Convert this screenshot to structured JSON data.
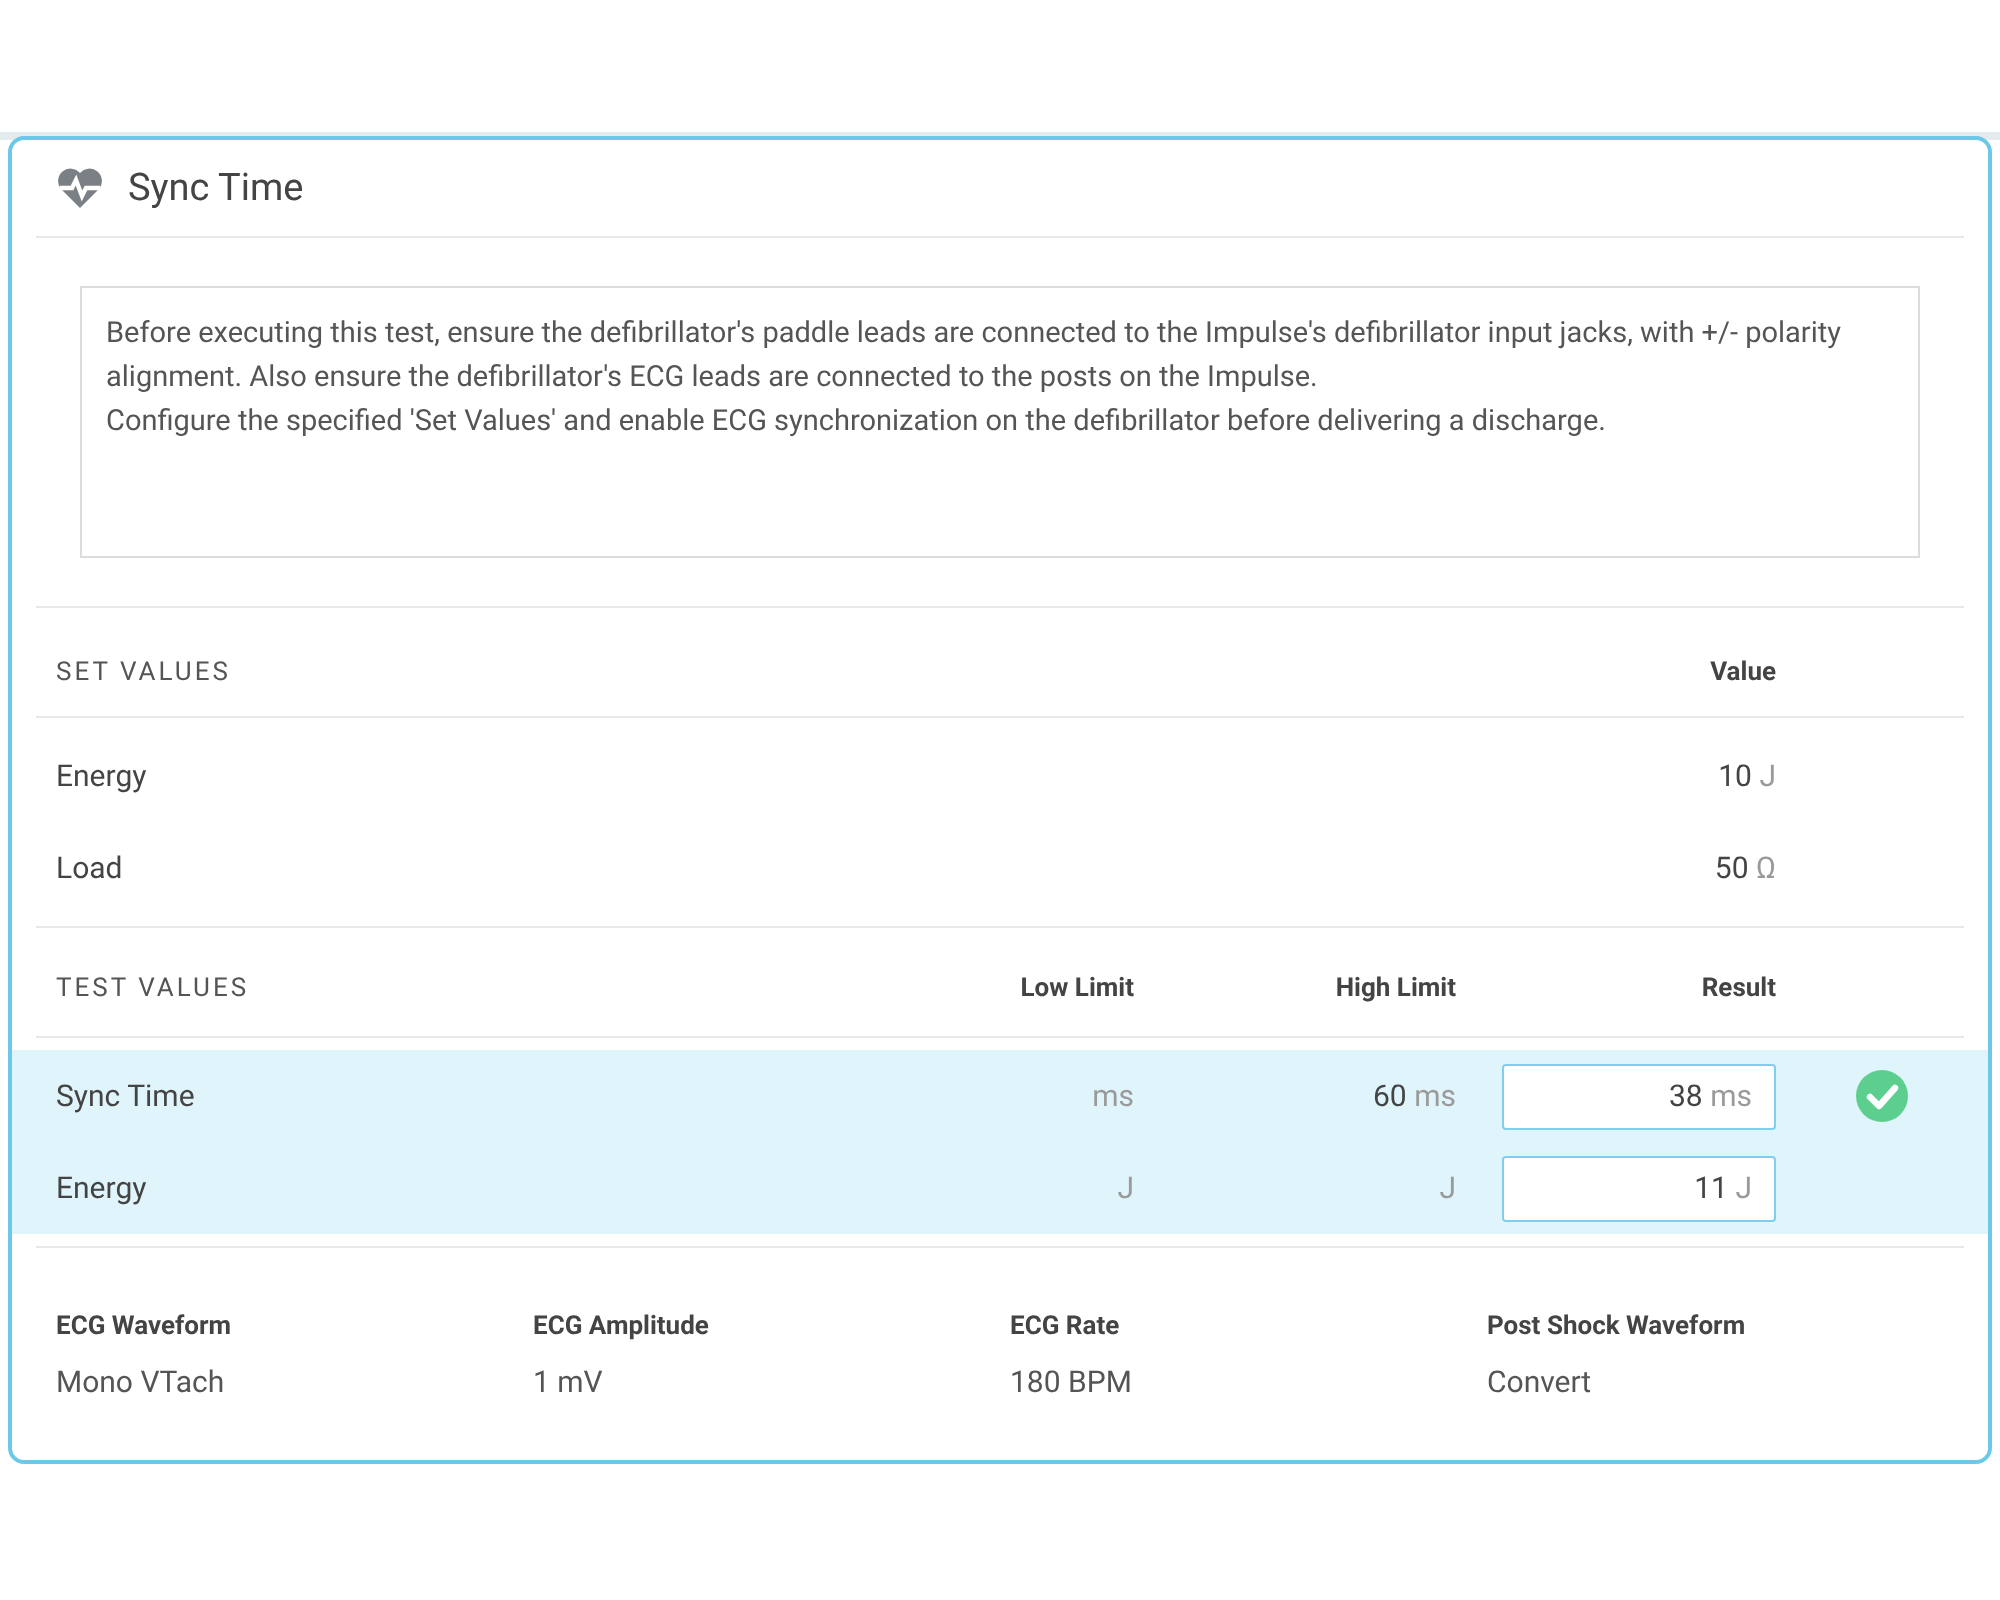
{
  "panel": {
    "title": "Sync Time"
  },
  "instructions": [
    "Before executing this test, ensure the defibrillator's paddle leads are connected to the Impulse's defibrillator input jacks, with +/- polarity alignment. Also ensure the defibrillator's ECG leads are connected to the posts on the Impulse.",
    "Configure the specified 'Set Values' and enable ECG synchronization on the defibrillator before delivering a discharge."
  ],
  "set_values": {
    "heading": "SET VALUES",
    "value_column": "Value",
    "rows": [
      {
        "label": "Energy",
        "value": "10",
        "unit": "J"
      },
      {
        "label": "Load",
        "value": "50",
        "unit": "Ω"
      }
    ]
  },
  "test_values": {
    "heading": "TEST VALUES",
    "columns": [
      "Low Limit",
      "High Limit",
      "Result"
    ],
    "rows": [
      {
        "label": "Sync Time",
        "highlighted": true,
        "low": {
          "unit": "ms"
        },
        "high": {
          "value": "60",
          "unit": "ms"
        },
        "result": {
          "value": "38",
          "unit": "ms"
        },
        "passed": true
      },
      {
        "label": "Energy",
        "highlighted": true,
        "low": {
          "unit": "J"
        },
        "high": {
          "unit": "J"
        },
        "result": {
          "value": "11",
          "unit": "J"
        },
        "passed": false
      }
    ]
  },
  "settings": [
    {
      "label": "ECG Waveform",
      "value": "Mono VTach"
    },
    {
      "label": "ECG Amplitude",
      "value": "1 mV"
    },
    {
      "label": "ECG Rate",
      "value": "180 BPM"
    },
    {
      "label": "Post Shock Waveform",
      "value": "Convert"
    }
  ]
}
